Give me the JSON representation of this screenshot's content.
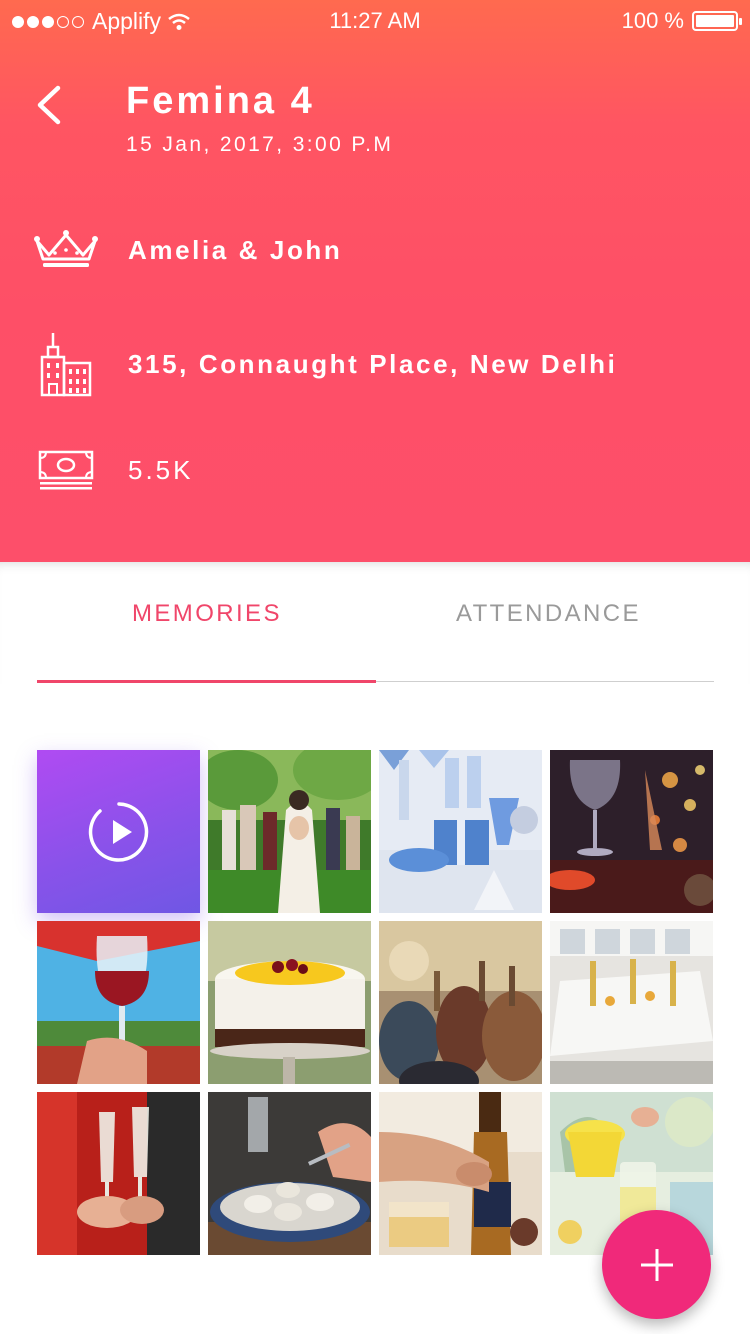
{
  "status_bar": {
    "carrier": "Applify",
    "time": "11:27 AM",
    "battery": "100 %"
  },
  "header": {
    "title": "Femina 4",
    "datetime": "15 Jan, 2017, 3:00 P.M",
    "details": [
      {
        "icon": "crown-icon",
        "text": "Amelia & John"
      },
      {
        "icon": "building-icon",
        "text": "315, Connaught Place, New Delhi"
      },
      {
        "icon": "money-icon",
        "text": "5.5K"
      }
    ]
  },
  "tabs": [
    {
      "label": "MEMORIES",
      "active": true
    },
    {
      "label": "ATTENDANCE",
      "active": false
    }
  ],
  "colors": {
    "header_top": "#ff6a4f",
    "header_main": "#fe4f67",
    "accent": "#f0466a",
    "fab": "#f0297a",
    "video_tile": "#9a4ff0"
  },
  "gallery": {
    "video_icon": "play-icon",
    "photos": [
      "wedding-party-photo",
      "blue-party-table-photo",
      "wine-glass-bokeh-photo",
      "red-wine-glass-photo",
      "cream-cake-photo",
      "concert-crowd-photo",
      "banquet-tables-photo",
      "champagne-toast-photo",
      "oyster-platter-photo",
      "beer-bottle-photo",
      "lemonade-jug-photo"
    ]
  },
  "fab": {
    "icon": "plus-icon"
  }
}
